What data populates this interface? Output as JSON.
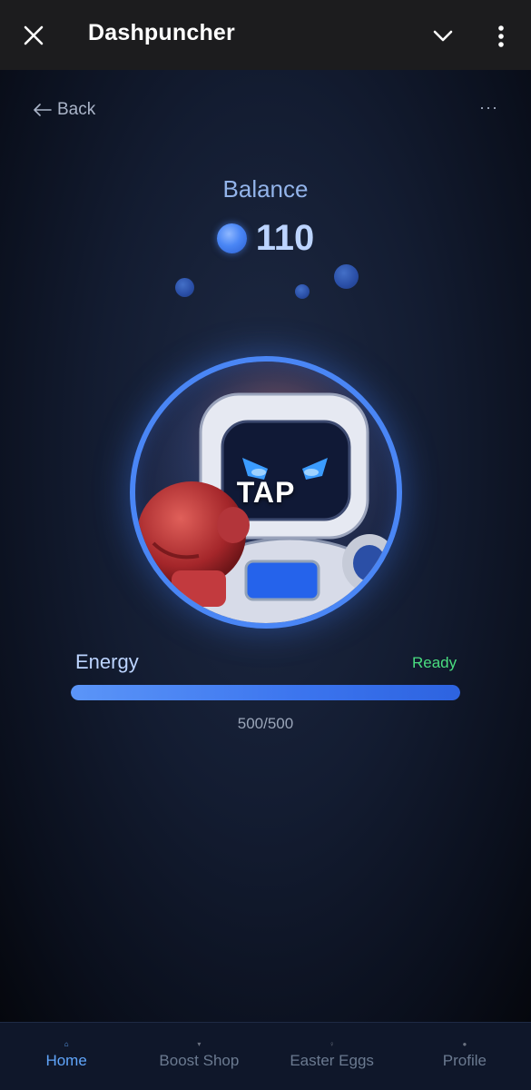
{
  "app": {
    "title": "Dashpuncher"
  },
  "header": {
    "back_label": "Back",
    "more_label": "···"
  },
  "balance": {
    "label": "Balance",
    "value": "110"
  },
  "tap": {
    "label": "TAP"
  },
  "energy": {
    "label": "Energy",
    "status": "Ready",
    "count": "500/500",
    "fill_fraction": 1.0
  },
  "nav": {
    "items": [
      {
        "label": "Home",
        "active": true
      },
      {
        "label": "Boost Shop",
        "active": false
      },
      {
        "label": "Easter Eggs",
        "active": false
      },
      {
        "label": "Profile",
        "active": false
      }
    ]
  },
  "colors": {
    "accent": "#4a86f5",
    "ready": "#4ade80",
    "active_nav": "#60a5fa"
  }
}
